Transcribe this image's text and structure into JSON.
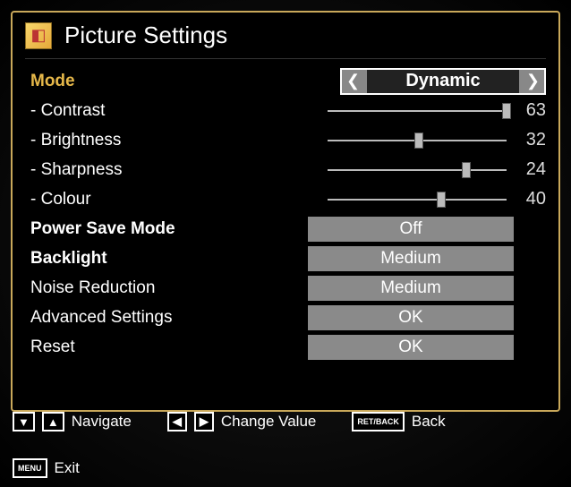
{
  "title": "Picture Settings",
  "mode": {
    "label": "Mode",
    "value": "Dynamic"
  },
  "sliders": {
    "contrast": {
      "label": "- Contrast",
      "value": 63,
      "min": 0,
      "max": 63
    },
    "brightness": {
      "label": "- Brightness",
      "value": 32,
      "min": 0,
      "max": 63
    },
    "sharpness": {
      "label": "- Sharpness",
      "value": 24,
      "min": 0,
      "max": 31
    },
    "colour": {
      "label": "- Colour",
      "value": 40,
      "min": 0,
      "max": 63
    }
  },
  "items": {
    "power_save": {
      "label": "Power Save Mode",
      "value": "Off"
    },
    "backlight": {
      "label": "Backlight",
      "value": "Medium"
    },
    "noise": {
      "label": "Noise Reduction",
      "value": "Medium"
    },
    "advanced": {
      "label": "Advanced Settings",
      "value": "OK"
    },
    "reset": {
      "label": "Reset",
      "value": "OK"
    }
  },
  "footer": {
    "navigate": "Navigate",
    "change": "Change Value",
    "back": "Back",
    "exit": "Exit",
    "keys": {
      "menu": "MENU",
      "retback": "RET/BACK"
    }
  }
}
